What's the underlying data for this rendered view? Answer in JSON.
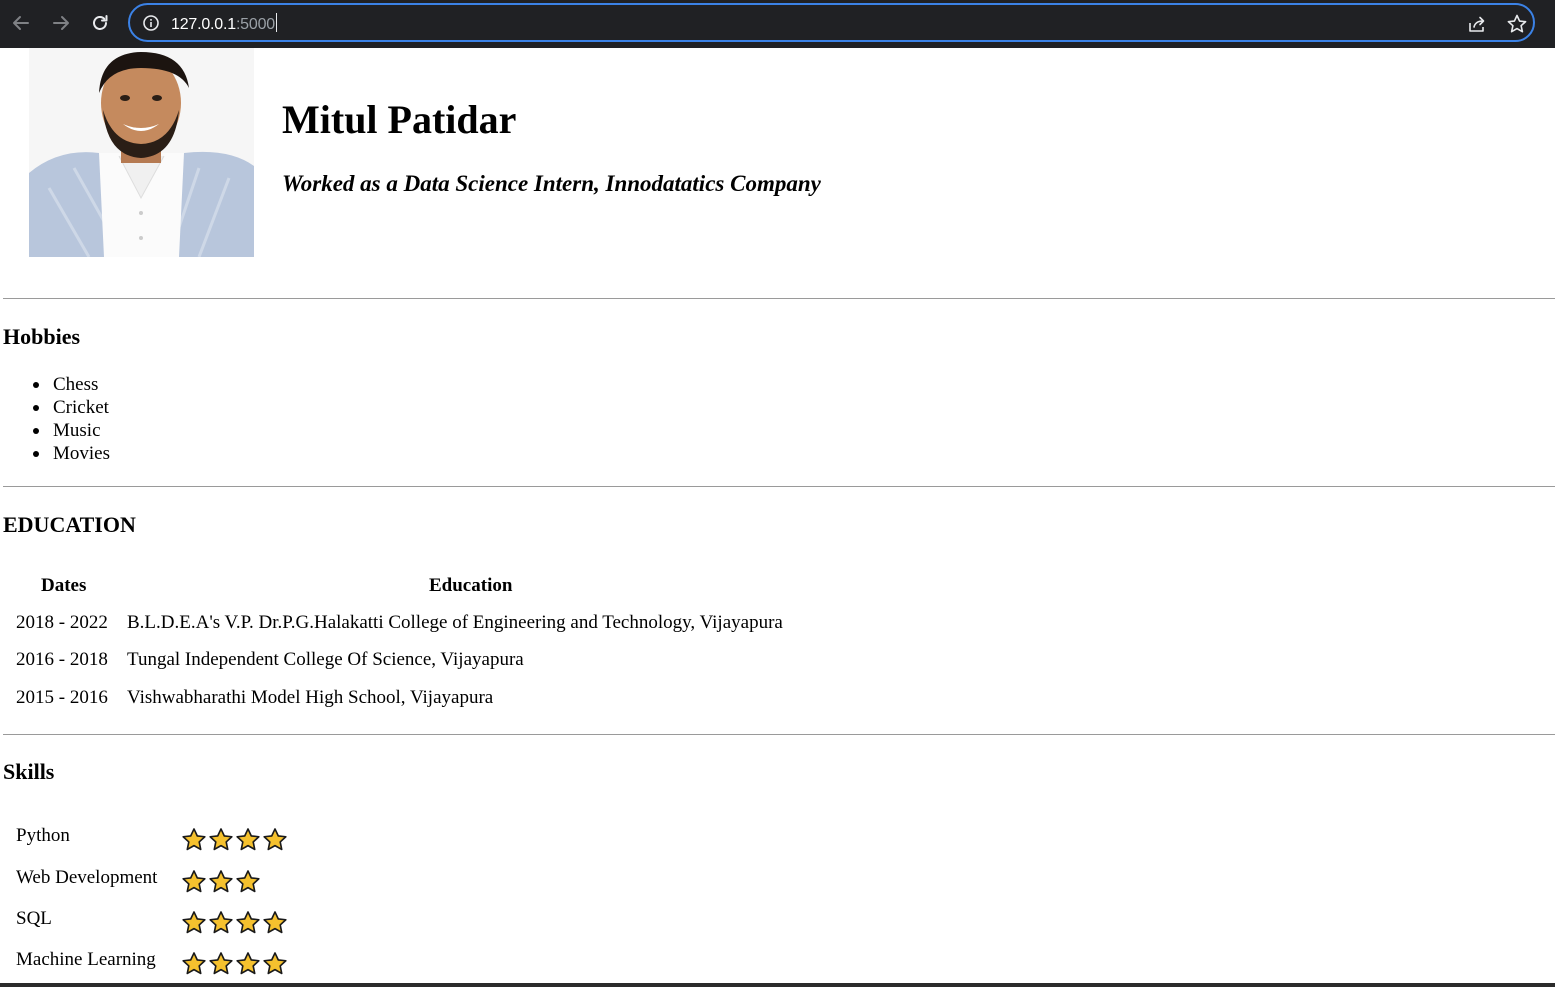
{
  "browser": {
    "url_host": "127.0.0.1",
    "url_port": ":5000"
  },
  "profile": {
    "name": "Mitul Patidar",
    "role": "Worked as a Data Science Intern, Innodatatics Company"
  },
  "hobbies": {
    "title": "Hobbies",
    "items": [
      "Chess",
      "Cricket",
      "Music",
      "Movies"
    ]
  },
  "education": {
    "title": "EDUCATION",
    "col_dates": "Dates",
    "col_education": "Education",
    "rows": [
      {
        "dates": "2018 - 2022",
        "school": "B.L.D.E.A's V.P. Dr.P.G.Halakatti College of Engineering and Technology, Vijayapura"
      },
      {
        "dates": "2016 - 2018",
        "school": "Tungal Independent College Of Science, Vijayapura"
      },
      {
        "dates": "2015 - 2016",
        "school": "Vishwabharathi Model High School, Vijayapura"
      }
    ]
  },
  "skills": {
    "title": "Skills",
    "items": [
      {
        "name": "Python",
        "stars": 4
      },
      {
        "name": "Web Development",
        "stars": 3
      },
      {
        "name": "SQL",
        "stars": 4
      },
      {
        "name": "Machine Learning",
        "stars": 4
      }
    ]
  },
  "colors": {
    "star_fill": "#f5c12e",
    "star_stroke": "#1a1a1a",
    "focus_ring": "#3b82e6"
  }
}
